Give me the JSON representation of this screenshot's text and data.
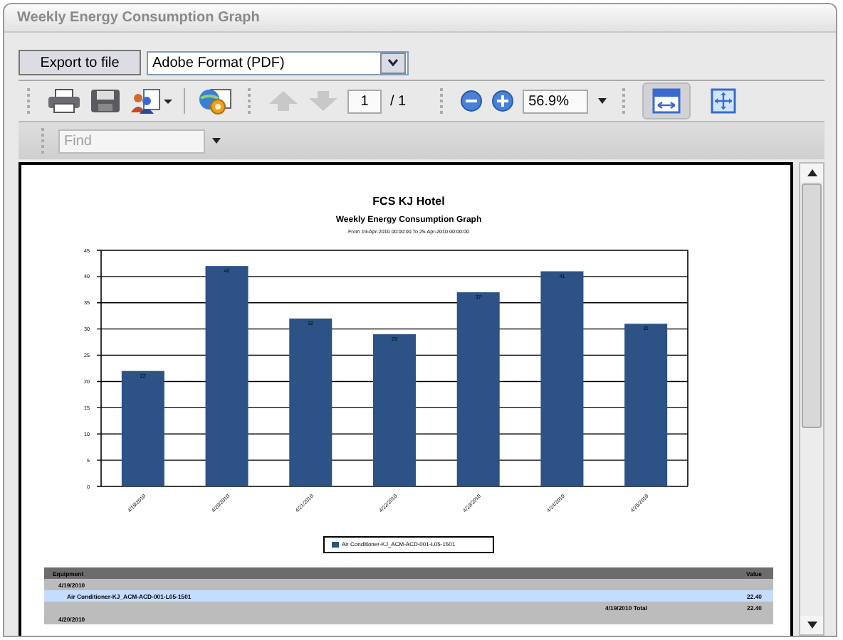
{
  "window": {
    "title": "Weekly Energy Consumption Graph"
  },
  "export": {
    "button": "Export to file",
    "format": "Adobe Format (PDF)"
  },
  "toolbar": {
    "page": "1",
    "page_count": "/ 1",
    "zoom": "56.9%",
    "views": [
      {
        "kind": "fit-width",
        "selected": true
      },
      {
        "kind": "fit-page",
        "selected": false
      }
    ]
  },
  "find": {
    "placeholder": "Find"
  },
  "report": {
    "title": "FCS KJ Hotel",
    "subtitle": "Weekly Energy Consumption Graph",
    "range": "From 19-Apr-2010 00:00:00 To 25-Apr-2010 00:00:00",
    "chart_data": {
      "type": "bar",
      "categories": [
        "4/19/2010",
        "4/20/2010",
        "4/21/2010",
        "4/22/2010",
        "4/23/2010",
        "4/24/2010",
        "4/25/2010"
      ],
      "series": [
        {
          "name": "Air Conditioner-KJ_ACM-ACD-001-L05-1501",
          "color": "#2c5286",
          "values": [
            22,
            42,
            32,
            29,
            37,
            41,
            31
          ]
        }
      ],
      "grid": true,
      "ylim": [
        0,
        45
      ],
      "yticks": [
        0,
        5,
        10,
        15,
        20,
        25,
        30,
        35,
        40,
        45
      ],
      "data_labels": true
    },
    "table": {
      "columns": [
        "Equipment",
        "Value"
      ],
      "rows": [
        {
          "kind": "group",
          "cells": [
            "4/19/2010"
          ]
        },
        {
          "kind": "detail",
          "cells": [
            "Air Conditioner-KJ_ACM-ACD-001-L05-1501",
            "22.40"
          ]
        },
        {
          "kind": "total",
          "cells": [
            "4/19/2010 Total",
            "22.40"
          ]
        },
        {
          "kind": "group",
          "cells": [
            "4/20/2010"
          ]
        }
      ]
    }
  }
}
